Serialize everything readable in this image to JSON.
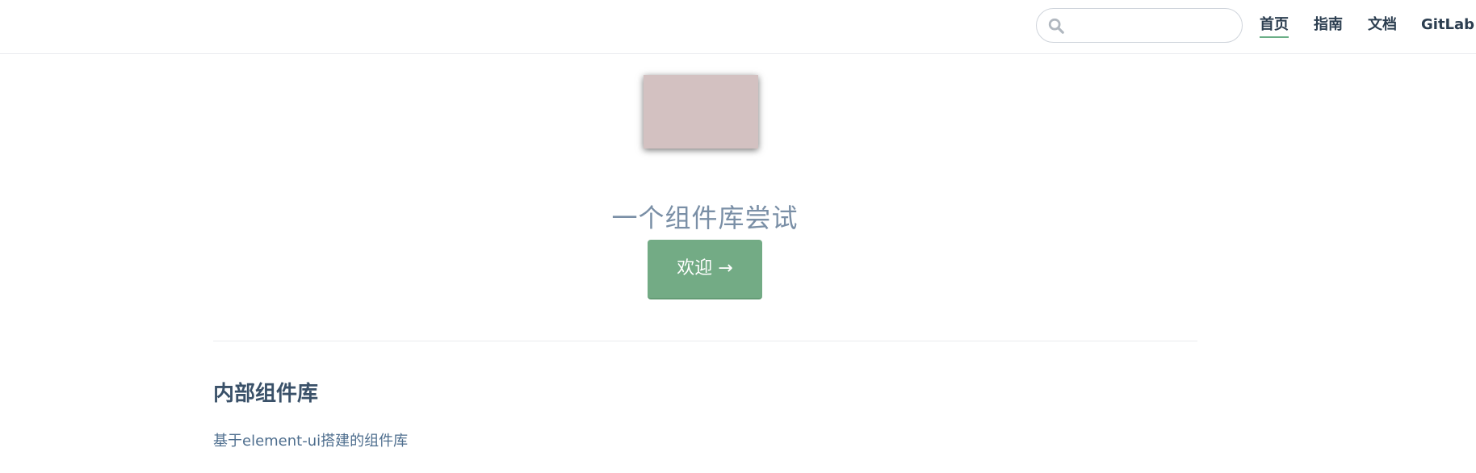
{
  "navbar": {
    "search": {
      "value": "",
      "placeholder": "",
      "icon": "search-icon"
    },
    "links": [
      {
        "label": "首页",
        "active": true
      },
      {
        "label": "指南",
        "active": false
      },
      {
        "label": "文档",
        "active": false
      },
      {
        "label": "GitLab",
        "active": false
      }
    ],
    "accent_color": "#6aae86"
  },
  "hero": {
    "image_color": "#d3c1c1",
    "description": "一个组件库尝试",
    "action_label": "欢迎 →",
    "action_color": "#73ab85"
  },
  "features": [
    {
      "title": "内部组件库",
      "details": "基于element-ui搭建的组件库"
    }
  ]
}
